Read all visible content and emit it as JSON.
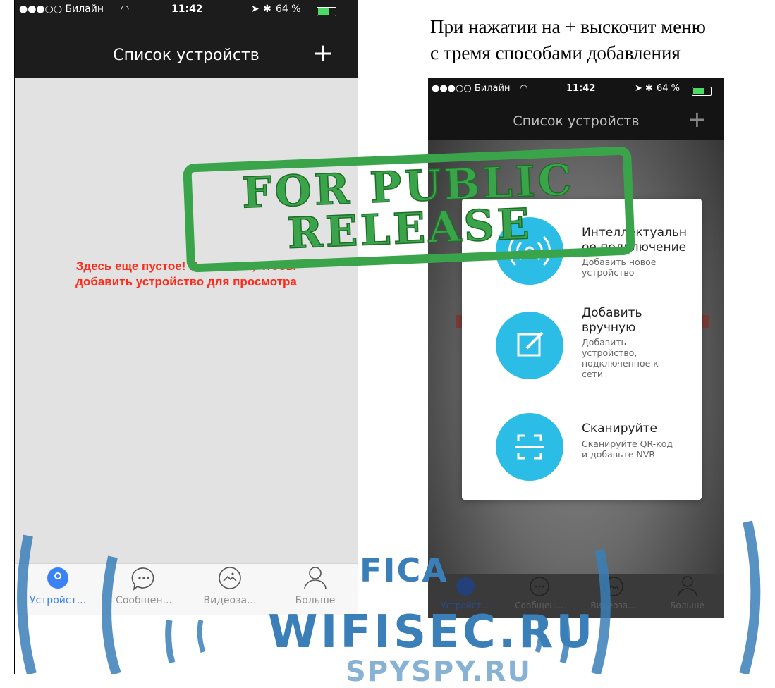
{
  "caption": {
    "line1": "При нажатии на + выскочит меню",
    "line2": "с тремя способами добавления"
  },
  "left_phone": {
    "status": {
      "carrier": "●●●○○ Билайн",
      "time": "11:42",
      "battery": "64 %"
    },
    "title": "Список устройств",
    "add_icon": "plus-icon",
    "empty_line1": "Здесь еще пустое! Нажмите +, чтобы",
    "empty_line2": "добавить устройство для просмотра",
    "tabs": [
      {
        "label": "Устройст...",
        "icon": "camera-icon",
        "active": true
      },
      {
        "label": "Сообщен...",
        "icon": "chat-icon",
        "active": false
      },
      {
        "label": "Видеоза...",
        "icon": "gallery-icon",
        "active": false
      },
      {
        "label": "Больше",
        "icon": "person-icon",
        "active": false
      }
    ]
  },
  "right_phone": {
    "status": {
      "carrier": "●●●○○ Билайн",
      "time": "11:42",
      "battery": "64 %"
    },
    "title": "Список устройств",
    "menu": [
      {
        "title": "Интеллектуальное подключение",
        "title_l1": "Интеллектуальн",
        "title_l2": "ое подключение",
        "sub_l1": "Добавить новое",
        "sub_l2": "устройство",
        "icon": "wifi-signal-icon"
      },
      {
        "title": "Добавить вручную",
        "title_l1": "Добавить",
        "title_l2": "вручную",
        "sub_l1": "Добавить",
        "sub_l2": "устройство,",
        "sub_l3": "подключенное к",
        "sub_l4": "сети",
        "icon": "edit-icon"
      },
      {
        "title": "Сканируйте",
        "sub_l1": "Сканируйте QR-код",
        "sub_l2": "и добавьте NVR",
        "icon": "scan-icon"
      }
    ],
    "tabs": [
      {
        "label": "Устройст..."
      },
      {
        "label": "Сообщен..."
      },
      {
        "label": "Видеоза..."
      },
      {
        "label": "Больше"
      }
    ]
  },
  "stamp": {
    "line1": "FOR PUBLIC",
    "line2": "RELEASE"
  },
  "watermark": {
    "brand": "WIFISEC.RU",
    "partial_top": "FICA",
    "partial_bottom": "SPYSPY.RU"
  },
  "colors": {
    "accent_blue": "#2bbde6",
    "tab_active": "#3b82f6",
    "empty_text": "#ff2a1a",
    "stamp_green": "#3aa44a"
  }
}
